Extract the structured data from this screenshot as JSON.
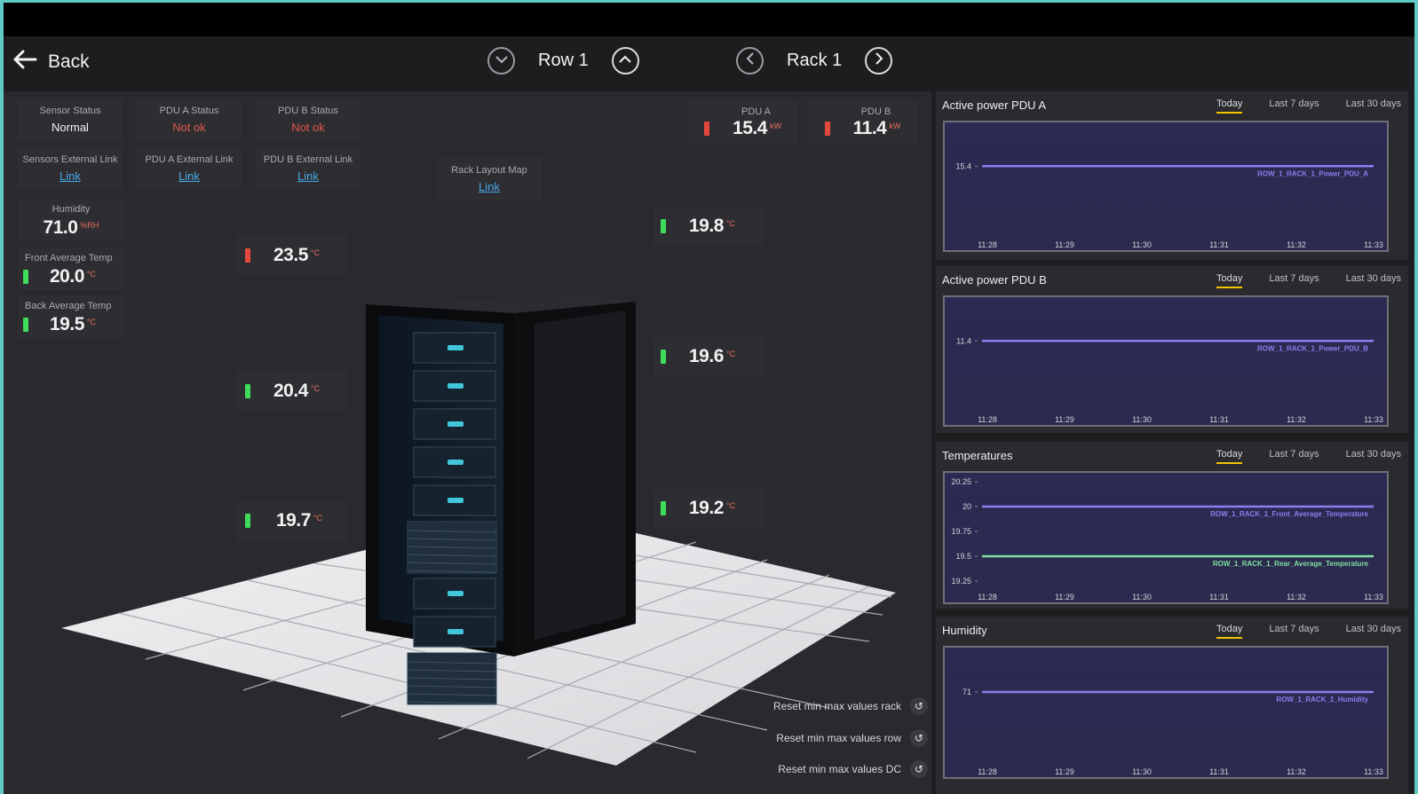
{
  "header": {
    "back_label": "Back",
    "row_label": "Row 1",
    "rack_label": "Rack 1"
  },
  "status": {
    "sensor_status_title": "Sensor Status",
    "sensor_status_value": "Normal",
    "pdu_a_status_title": "PDU A Status",
    "pdu_a_status_value": "Not ok",
    "pdu_b_status_title": "PDU B Status",
    "pdu_b_status_value": "Not ok",
    "sensors_link_title": "Sensors External Link",
    "pdu_a_link_title": "PDU A External Link",
    "pdu_b_link_title": "PDU B External Link",
    "link_label": "Link",
    "rack_layout_title": "Rack Layout Map"
  },
  "metrics": {
    "humidity_title": "Humidity",
    "humidity_value": "71.0",
    "humidity_unit": "%RH",
    "front_temp_title": "Front Average Temp",
    "front_temp_value": "20.0",
    "back_temp_title": "Back Average Temp",
    "back_temp_value": "19.5",
    "temp_unit": "°C",
    "pdu_a_title": "PDU A",
    "pdu_a_value": "15.4",
    "pdu_b_title": "PDU B",
    "pdu_b_value": "11.4",
    "power_unit": "kW",
    "front_sensors": [
      "23.5",
      "20.4",
      "19.7"
    ],
    "back_sensors": [
      "19.8",
      "19.6",
      "19.2"
    ]
  },
  "reset": {
    "rack": "Reset min max values rack",
    "row": "Reset min max values row",
    "dc": "Reset min max values DC"
  },
  "tabs": [
    "Today",
    "Last 7 days",
    "Last 30 days"
  ],
  "colors": {
    "ok": "#3ddc5a",
    "bad": "#e2483c",
    "series_purple": "#8a7ff0",
    "series_green": "#7fe0a0",
    "accent_tab": "#f0c400"
  },
  "chart_data": [
    {
      "type": "line",
      "title": "Active power PDU A",
      "x": [
        "11:28",
        "11:29",
        "11:30",
        "11:31",
        "11:32",
        "11:33"
      ],
      "series": [
        {
          "name": "ROW_1_RACK_1_Power_PDU_A",
          "values": [
            15.4,
            15.4,
            15.4,
            15.4,
            15.4,
            15.4
          ]
        }
      ],
      "yticks": [
        "15.4"
      ]
    },
    {
      "type": "line",
      "title": "Active power PDU B",
      "x": [
        "11:28",
        "11:29",
        "11:30",
        "11:31",
        "11:32",
        "11:33"
      ],
      "series": [
        {
          "name": "ROW_1_RACK_1_Power_PDU_B",
          "values": [
            11.4,
            11.4,
            11.4,
            11.4,
            11.4,
            11.4
          ]
        }
      ],
      "yticks": [
        "11.4"
      ]
    },
    {
      "type": "line",
      "title": "Temperatures",
      "x": [
        "11:28",
        "11:29",
        "11:30",
        "11:31",
        "11:32",
        "11:33"
      ],
      "series": [
        {
          "name": "ROW_1_RACK_1_Front_Average_Temperature",
          "values": [
            20,
            20,
            20,
            20,
            20,
            20
          ]
        },
        {
          "name": "ROW_1_RACK_1_Rear_Average_Temperature",
          "values": [
            19.5,
            19.5,
            19.5,
            19.5,
            19.5,
            19.5
          ]
        }
      ],
      "yticks": [
        "20.25",
        "20",
        "19.75",
        "19.5",
        "19.25"
      ],
      "ylim": [
        19.25,
        20.25
      ]
    },
    {
      "type": "line",
      "title": "Humidity",
      "x": [
        "11:28",
        "11:29",
        "11:30",
        "11:31",
        "11:32",
        "11:33"
      ],
      "series": [
        {
          "name": "ROW_1_RACK_1_Humidity",
          "values": [
            71,
            71,
            71,
            71,
            71,
            71
          ]
        }
      ],
      "yticks": [
        "71"
      ]
    }
  ]
}
